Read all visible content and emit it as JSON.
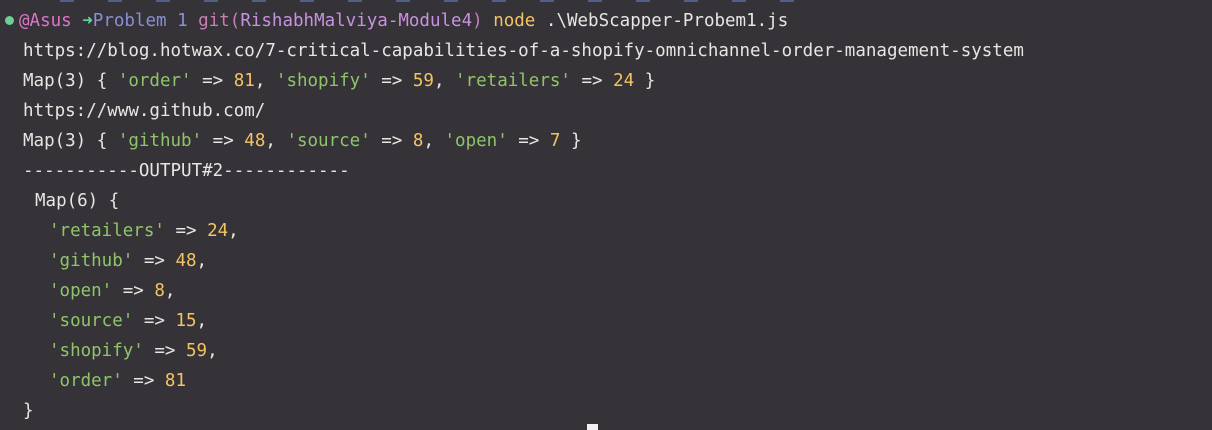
{
  "prompt": {
    "user": "@Asus",
    "arrow": "➜",
    "dir": "Problem 1",
    "git_label": "git(",
    "branch": "RishabhMalviya-Module4",
    "git_close": ")",
    "command": "node",
    "args": ".\\WebScapper-Probem1.js"
  },
  "output": {
    "url1": "https://blog.hotwax.co/7-critical-capabilities-of-a-shopify-omnichannel-order-management-system",
    "map1": {
      "head": "Map(3) { ",
      "entries": [
        {
          "key": "'order'",
          "value": "81"
        },
        {
          "key": "'shopify'",
          "value": "59"
        },
        {
          "key": "'retailers'",
          "value": "24"
        }
      ],
      "tail": " }"
    },
    "url2": "https://www.github.com/",
    "map2": {
      "head": "Map(3) { ",
      "entries": [
        {
          "key": "'github'",
          "value": "48"
        },
        {
          "key": "'source'",
          "value": "8"
        },
        {
          "key": "'open'",
          "value": "7"
        }
      ],
      "tail": " }"
    },
    "separator": "-----------OUTPUT#2------------",
    "map3": {
      "head": "Map(6) {",
      "entries": [
        {
          "key": "'retailers'",
          "value": "24",
          "sep": ","
        },
        {
          "key": "'github'",
          "value": "48",
          "sep": ","
        },
        {
          "key": "'open'",
          "value": "8",
          "sep": ","
        },
        {
          "key": "'source'",
          "value": "15",
          "sep": ","
        },
        {
          "key": "'shopify'",
          "value": "59",
          "sep": ","
        },
        {
          "key": "'order'",
          "value": "81",
          "sep": ""
        }
      ],
      "tail": "}"
    },
    "fat_arrow": " => ",
    "comma": ", "
  },
  "colors": {
    "background": "#353337",
    "string": "#8fc56a",
    "number": "#f4c463",
    "user": "#df74c8",
    "arrow": "#65d6a3",
    "directory": "#8a8fd6",
    "branch": "#c792e0"
  },
  "icons": {
    "status_dot": "green-dot-icon",
    "cursor": "block-cursor"
  }
}
